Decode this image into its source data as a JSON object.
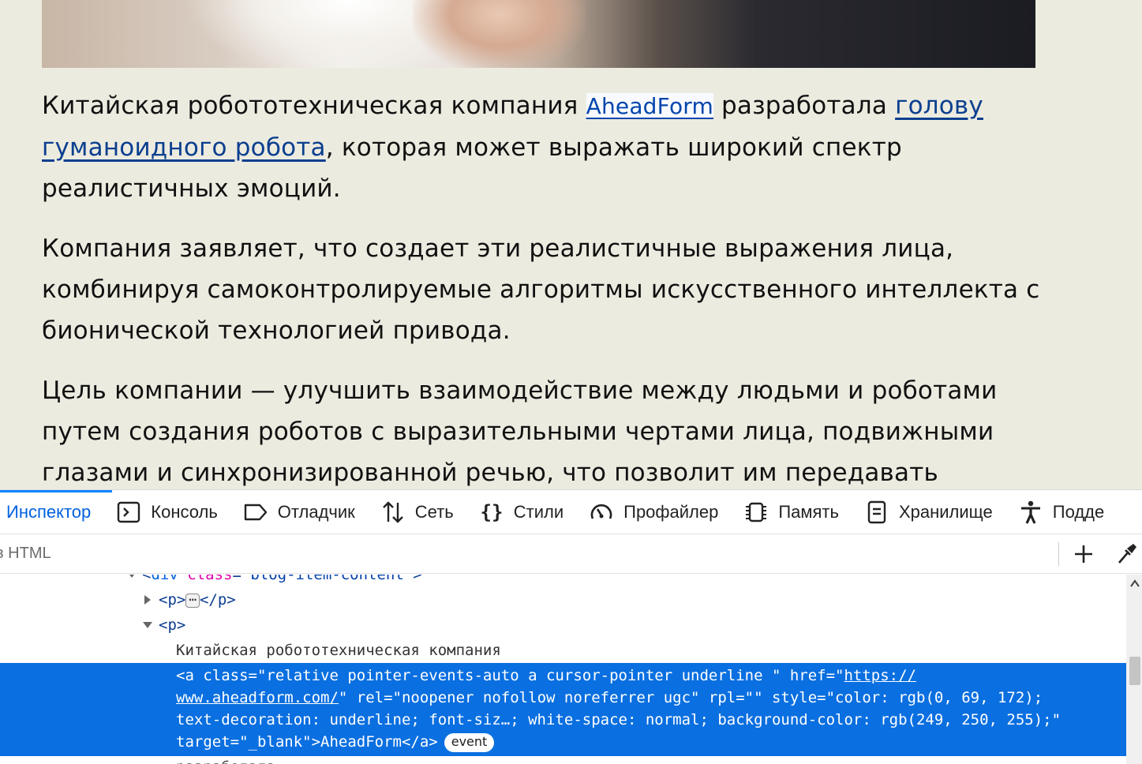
{
  "article": {
    "p1": {
      "t1": "Китайская робототехническая компания ",
      "link1": "AheadForm",
      "t2": " разработала ",
      "link2": "голову гуманоидного робота",
      "t3": ", которая может выражать широкий спектр реалистичных эмоций."
    },
    "p2": "Компания заявляет, что создает эти реалистичные выражения лица, комбинируя самоконтролируемые алгоритмы искусственного интеллекта с бионической технологией привода.",
    "p3": "Цель компании — улучшить взаимодействие между людьми и роботами путем создания роботов с выразительными чертами лица, подвижными глазами и синхронизированной речью, что позволит им передавать"
  },
  "devtools": {
    "tabs": [
      {
        "label": "Инспектор",
        "icon": "inspector-icon"
      },
      {
        "label": "Консоль",
        "icon": "console-icon"
      },
      {
        "label": "Отладчик",
        "icon": "debugger-icon"
      },
      {
        "label": "Сеть",
        "icon": "network-icon"
      },
      {
        "label": "Стили",
        "icon": "style-editor-icon"
      },
      {
        "label": "Профайлер",
        "icon": "profiler-icon"
      },
      {
        "label": "Память",
        "icon": "memory-icon"
      },
      {
        "label": "Хранилище",
        "icon": "storage-icon"
      },
      {
        "label": "Подде",
        "icon": "accessibility-icon"
      }
    ],
    "search_placeholder": "в HTML",
    "markup": {
      "div_open": {
        "tag": "div",
        "attr": "class",
        "val": "\"blog-item-content\""
      },
      "p_collapsed": {
        "open": "<p>",
        "ellipsis": "⋯",
        "close": "</p>"
      },
      "p_open": "<p>",
      "text_node": "Китайская робототехническая компания",
      "selected": {
        "l1a": "<a class=\"relative pointer-events-auto a cursor-pointer underline \" href=\"",
        "l1b": "https://",
        "l2a": "www.aheadform.com/",
        "l2b": "\" rel=\"noopener nofollow noreferrer ugc\" rpl=\"\" style=\"color: rgb(0, 69, 172);",
        "l3": "text-decoration: underline; font-siz…; white-space: normal; background-color: rgb(249, 250, 255);\"",
        "l4": "target=\"_blank\">AheadForm</a>",
        "badge": "event"
      },
      "next_text": "разработала"
    }
  }
}
